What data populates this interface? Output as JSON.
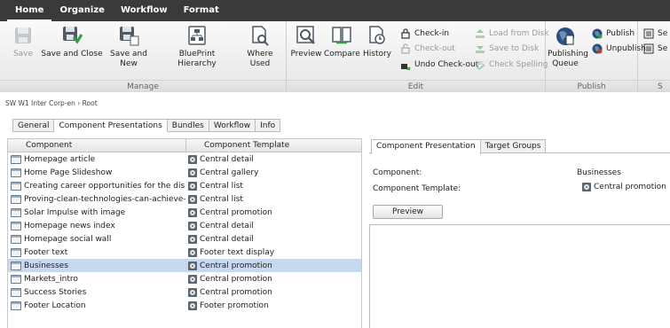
{
  "menu": {
    "tabs": [
      "Home",
      "Organize",
      "Workflow",
      "Format"
    ]
  },
  "ribbon": {
    "manage": {
      "label": "Manage",
      "save": "Save",
      "save_close": "Save and Close",
      "save_new_1": "Save and",
      "save_new_2": "New",
      "blueprint": "BluePrint Hierarchy",
      "where_used": "Where Used"
    },
    "edit": {
      "label": "Edit",
      "preview": "Preview",
      "compare": "Compare",
      "history": "History",
      "check_in": "Check-in",
      "check_out": "Check-out",
      "undo_check_out": "Undo Check-out",
      "load_from_disk": "Load from Disk",
      "save_to_disk": "Save to Disk",
      "check_spelling": "Check Spelling"
    },
    "publish": {
      "label": "Publish",
      "queue_1": "Publishing",
      "queue_2": "Queue",
      "publish": "Publish",
      "unpublish": "Unpublish"
    },
    "extra": {
      "label": "S",
      "se1": "Se",
      "se2": "Se"
    }
  },
  "breadcrumb": {
    "path": "SW W1 Inter Corp-en",
    "sep": "›",
    "leaf": "Root"
  },
  "tabs": [
    "General",
    "Component Presentations",
    "Bundles",
    "Workflow",
    "Info"
  ],
  "grid": {
    "headers": {
      "component": "Component",
      "template": "Component Template"
    },
    "rows": [
      {
        "component": "Homepage article",
        "template": "Central detail"
      },
      {
        "component": "Home Page Slideshow",
        "template": "Central gallery"
      },
      {
        "component": "Creating career opportunities for the dis",
        "template": "Central list"
      },
      {
        "component": "Proving-clean-technologies-can-achieve-",
        "template": "Central list"
      },
      {
        "component": "Solar Impulse with image",
        "template": "Central promotion"
      },
      {
        "component": "Homepage news index",
        "template": "Central detail"
      },
      {
        "component": "Homepage social wall",
        "template": "Central detail"
      },
      {
        "component": "Footer text",
        "template": "Footer text display"
      },
      {
        "component": "Businesses",
        "template": "Central promotion"
      },
      {
        "component": "Markets_intro",
        "template": "Central promotion"
      },
      {
        "component": "Success Stories",
        "template": "Central promotion"
      },
      {
        "component": "Footer Location",
        "template": "Footer promotion"
      }
    ]
  },
  "panel": {
    "tabs": [
      "Component Presentation",
      "Target Groups"
    ],
    "component_label": "Component:",
    "component_value": "Businesses",
    "template_label": "Component Template:",
    "template_value": "Central promotion",
    "preview_button": "Preview"
  }
}
